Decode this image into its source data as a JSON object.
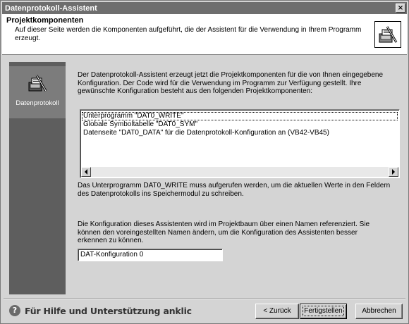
{
  "window": {
    "title": "Datenprotokoll-Assistent",
    "close_label": "×"
  },
  "header": {
    "title": "Projektkomponenten",
    "description": "Auf dieser Seite werden die Komponenten aufgeführt, die der Assistent für die Verwendung in Ihrem Programm erzeugt.",
    "icon": "data-log-wizard-icon"
  },
  "sidebar": {
    "items": [
      {
        "label": "Datenprotokoll",
        "icon": "data-log-wizard-icon",
        "selected": true
      }
    ]
  },
  "main": {
    "intro": "Der Datenprotokoll-Assistent erzeugt jetzt die Projektkomponenten für die von Ihnen eingegebene Konfiguration. Der Code wird für die Verwendung im Programm zur Verfügung gestellt. Ihre gewünschte Konfiguration besteht aus den folgenden Projektkomponenten:",
    "components": [
      "Unterprogramm \"DAT0_WRITE\"",
      "Globale Symboltabelle \"DAT0_SYM\"",
      "Datenseite \"DAT0_DATA\" für die Datenprotokoll-Konfiguration an (VB42-VB45)"
    ],
    "note": "Das Unterprogramm DAT0_WRITE muss aufgerufen werden, um die aktuellen Werte in den Feldern des Datenprotokolls ins Speichermodul zu schreiben.",
    "config_description": "Die Konfiguration dieses Assistenten wird im Projektbaum über einen Namen referenziert. Sie können den voreingestellten Namen ändern, um die Konfiguration des Assistenten besser erkennen zu können.",
    "config_name": "DAT-Konfiguration 0"
  },
  "footer": {
    "help_text": "Für Hilfe und Unterstützung anklic",
    "help_icon": "question-icon",
    "back_label": "< Zurück",
    "finish_label": "Fertigstellen",
    "cancel_label": "Abbrechen"
  }
}
